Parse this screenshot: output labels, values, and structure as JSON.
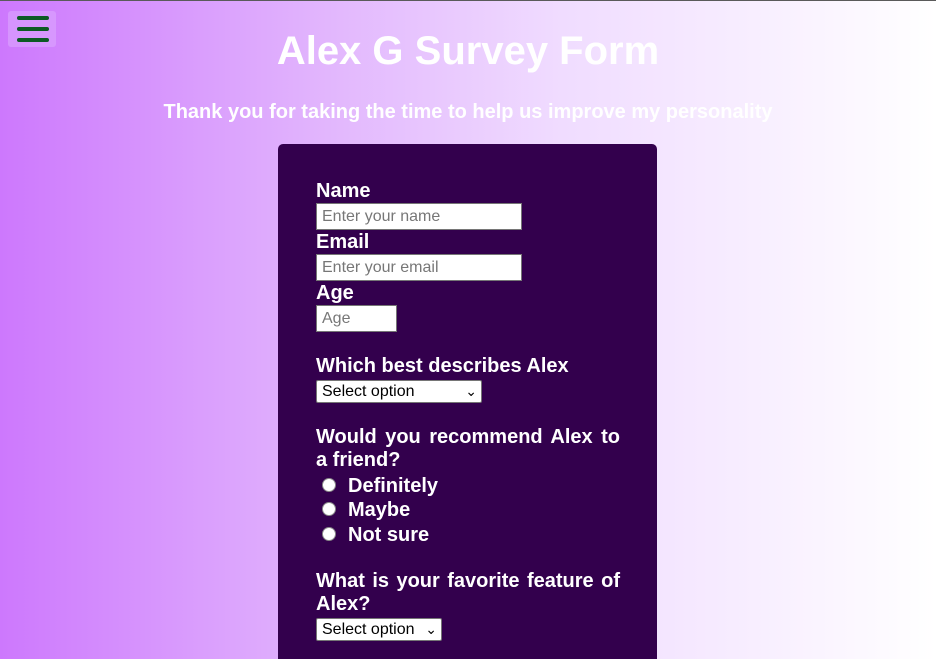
{
  "header": {
    "title": "Alex G Survey Form",
    "subtitle": "Thank you for taking the time to help us improve my personality"
  },
  "menu": {
    "icon": "hamburger-menu-icon",
    "icon_color": "#0c5a24"
  },
  "form": {
    "name_label": "Name",
    "name_placeholder": "Enter your name",
    "email_label": "Email",
    "email_placeholder": "Enter your email",
    "age_label": "Age",
    "age_placeholder": "Age",
    "describe_label": "Which best describes Alex",
    "describe_selected": "Select option",
    "recommend_question": "Would you recommend Alex to a friend?",
    "recommend_options": [
      "Definitely",
      "Maybe",
      "Not sure"
    ],
    "feature_question": "What is your favorite feature of Alex?",
    "feature_selected": "Select option"
  },
  "colors": {
    "card_background": "#33004d",
    "gradient_start": "#cd78fd",
    "gradient_end": "#ffffff",
    "text": "#ffffff"
  }
}
